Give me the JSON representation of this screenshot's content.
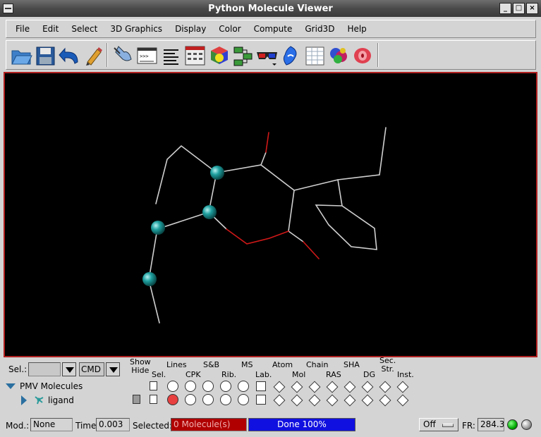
{
  "window": {
    "title": "Python Molecule Viewer"
  },
  "menu": [
    "File",
    "Edit",
    "Select",
    "3D Graphics",
    "Display",
    "Color",
    "Compute",
    "Grid3D",
    "Help"
  ],
  "toolbar_icons": [
    "open-folder-icon",
    "save-disk-icon",
    "undo-arrow-icon",
    "pencil-icon",
    "pick-hand-icon",
    "python-shell-icon",
    "text-lines-icon",
    "dashboard-icon",
    "color-cube-icon",
    "circuit-icon",
    "3d-glasses-icon",
    "surface-shape-icon",
    "spreadsheet-icon",
    "molecule-surface-icon",
    "red-blob-icon"
  ],
  "molecule": {
    "bond_color": "#cfcfcf",
    "oxygen_color": "#d01818",
    "selected_atom_color": "#1fa0a0"
  },
  "dashboard": {
    "sel_label": "Sel.:",
    "cmd_label": "CMD",
    "tree_root": "PMV Molecules",
    "tree_child": "ligand",
    "columns": {
      "show_hide": "Show\nHide",
      "sel": "Sel.",
      "lines": "Lines",
      "cpk": "CPK",
      "sb": "S&B",
      "rib": "Rib.",
      "ms": "MS",
      "lab": "Lab.",
      "atom": "Atom",
      "mol": "Mol",
      "chain": "Chain",
      "ras": "RAS",
      "sha": "SHA",
      "dg": "DG",
      "sec_str": "Sec.\nStr.",
      "inst": "Inst."
    },
    "ligand_lines_on": true
  },
  "status": {
    "mod_label": "Mod.:",
    "mod_value": "None",
    "time_label": "Time:",
    "time_value": "0.003",
    "selected_label": "Selected:",
    "selected_value": "0 Molecule(s)",
    "progress_text": "Done 100%",
    "progress_percent": 100,
    "spin_mode": "Off",
    "fr_label": "FR:",
    "fr_value": "284.3"
  }
}
